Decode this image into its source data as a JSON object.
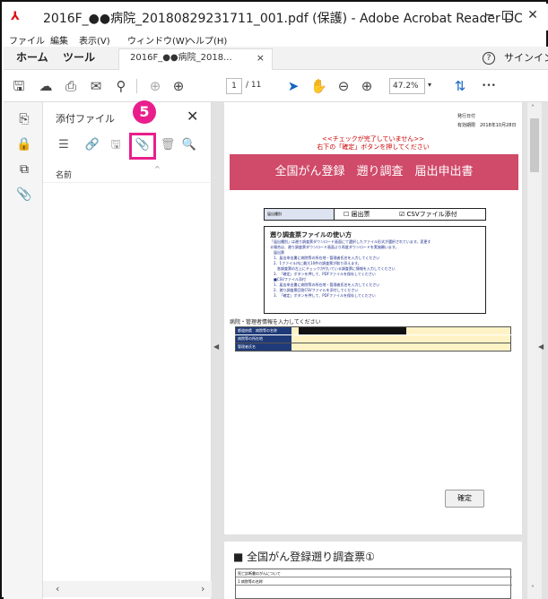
{
  "window": {
    "title": "2016F_●●病院_20180829231711_001.pdf (保護) - Adobe Acrobat Reader DC",
    "minimize": "−",
    "close": "✕"
  },
  "menu": [
    "ファイル",
    "編集",
    "表示(V)",
    "ウィンドウ(W)",
    "ヘルプ(H)"
  ],
  "tabs": {
    "home": "ホーム",
    "tools": "ツール",
    "doc": "2016F_●●病院_2018...",
    "doc_close": "×",
    "help": "?",
    "signin": "サインイン"
  },
  "toolbar": {
    "page_current": "1",
    "page_total": "/ 11",
    "zoom": "47.2%",
    "zoom_dropdown": "▾",
    "more": "•••"
  },
  "attachments": {
    "title": "添付ファイル",
    "close": "✕",
    "col_name": "名前",
    "sort_caret": "^",
    "badge": "5",
    "scroll_left": "‹",
    "scroll_right": "›"
  },
  "viewer": {
    "split_left": "◀",
    "split_right": "◀",
    "scroll_up": "˄",
    "scroll_down": "˅"
  },
  "pdf": {
    "issue_date_label": "発行日付",
    "issue_date": "有効期限　2018年10月28日",
    "warn_line1": "<<チェックが完了していません>>",
    "warn_line2": "右下の「確定」ボタンを押してください",
    "banner": "全国がん登録　遡り調査　届出申出書",
    "type_label": "届出種別",
    "opt_paper": "☐ 届出票",
    "opt_csv": "☑ CSVファイル添付",
    "howto_title": "遡り調査票ファイルの使い方",
    "howto_lines": [
      "「届出種別」は遡り調査票ダウンロード画面にて選択したファイル形式が選択されています。変更す",
      "る場合は、遡り調査票ダウンロード画面より再度ダウンロードを実施願います。",
      "　届出票",
      "　1．届出申出書に病院等の所在地・管理者氏名を入力してください",
      "　2．1ファイル内に最大10件の調査票が取り添えます。",
      "　　各調査票の左上にチェックが付いている調査票に情報を入力してください",
      "　3．「確定」ボタンを押して、PDFファイルを保存してください",
      "",
      "　■CSVファイル添付",
      "　1．届出申出書に病院等の所在地・管理者氏名を入力してください",
      "　2．遡り調査票回答CSVファイルを添付してください",
      "　3．「確定」ボタンを押して、PDFファイルを保存してください"
    ],
    "section_title": "病院・管理者情報を入力してください",
    "row1": "都道府県　病院等の名称",
    "row2": "病院等の所在地",
    "row3": "管理者氏名",
    "confirm": "確定",
    "page2_title": "■ 全国がん登録遡り調査票①",
    "page2_row1": "死亡診断書のがんについて",
    "page2_row2": "1 病院等の名称"
  }
}
